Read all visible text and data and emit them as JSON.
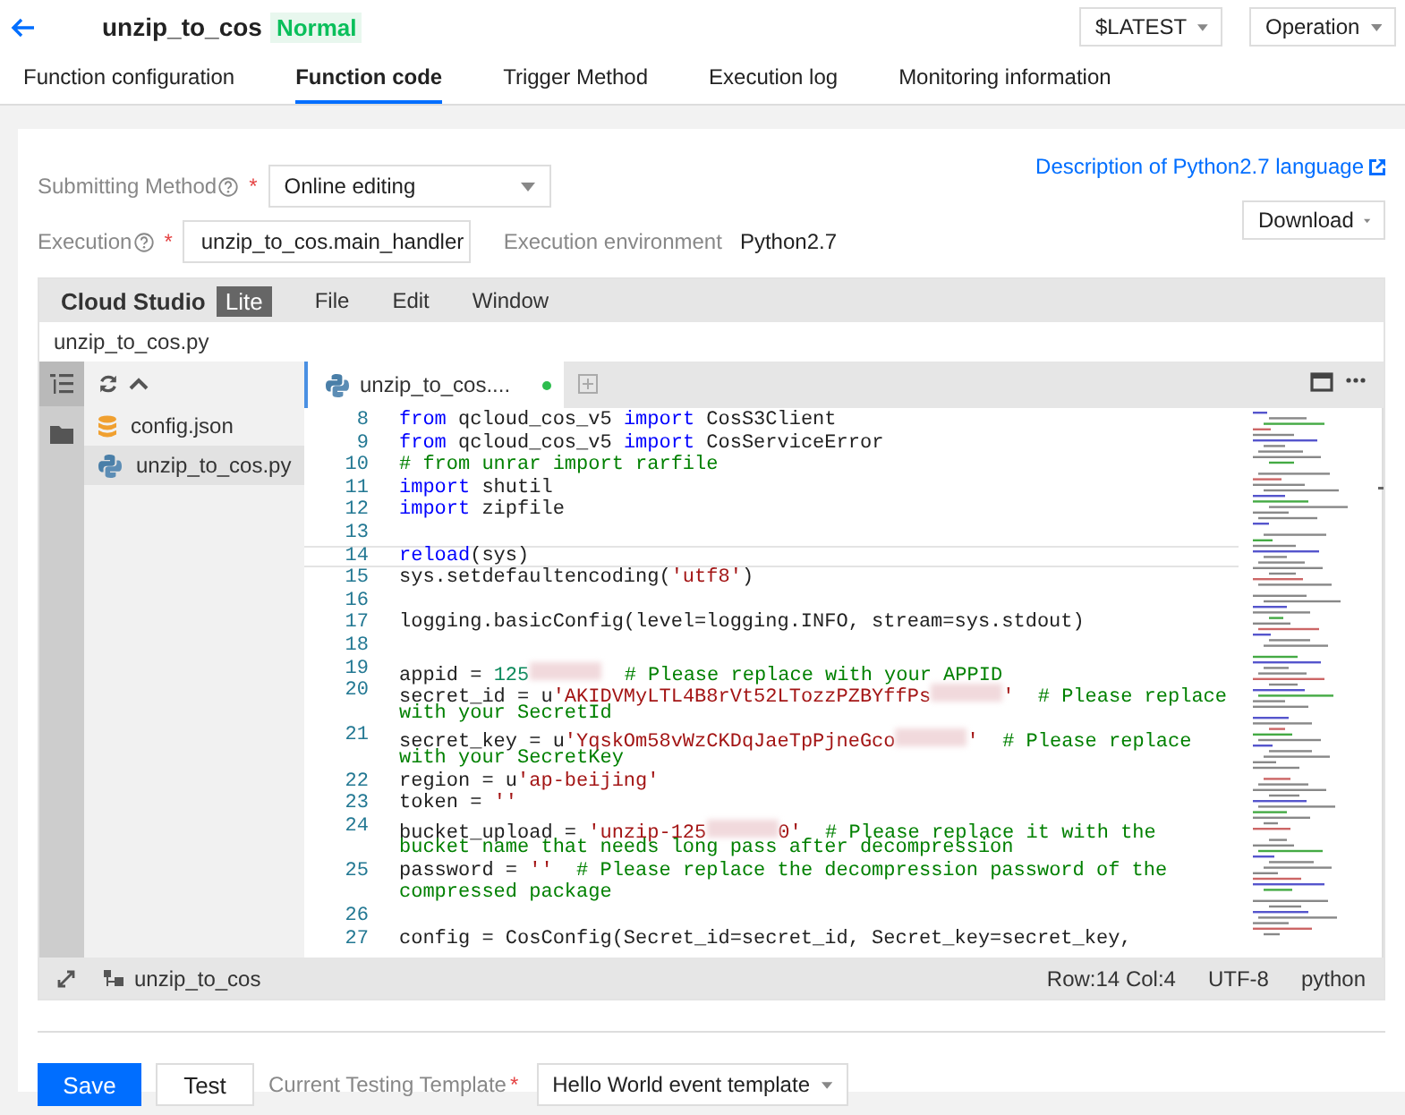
{
  "header": {
    "title": "unzip_to_cos",
    "status": "Normal",
    "version_select": "$LATEST",
    "operation_menu": "Operation"
  },
  "tabs": [
    {
      "label": "Function configuration",
      "selected": false
    },
    {
      "label": "Function code",
      "selected": true
    },
    {
      "label": "Trigger Method",
      "selected": false
    },
    {
      "label": "Execution log",
      "selected": false
    },
    {
      "label": "Monitoring information",
      "selected": false
    }
  ],
  "form": {
    "submitting_method": {
      "label": "Submitting Method",
      "required_mark": "*",
      "value": "Online editing"
    },
    "execution": {
      "label": "Execution",
      "required_mark": "*",
      "value": "unzip_to_cos.main_handler"
    },
    "environment": {
      "label": "Execution environment",
      "value": "Python2.7"
    },
    "language_link": "Description of Python2.7 language",
    "download_button": "Download"
  },
  "editor": {
    "brand": "Cloud Studio",
    "badge": "Lite",
    "menu": [
      "File",
      "Edit",
      "Window"
    ],
    "path": "unzip_to_cos.py",
    "files": [
      {
        "name": "config.json",
        "kind": "json",
        "selected": false
      },
      {
        "name": "unzip_to_cos.py",
        "kind": "python",
        "selected": true
      }
    ],
    "open_tab": {
      "label": "unzip_to_cos....",
      "modified": true
    },
    "rows": [
      {
        "num": "8",
        "current": false,
        "tokens": [
          {
            "kind": "keyword",
            "text": "from"
          },
          {
            "kind": "plain",
            "text": " qcloud_cos_v5 "
          },
          {
            "kind": "keyword",
            "text": "import"
          },
          {
            "kind": "plain",
            "text": " CosS3Client"
          }
        ]
      },
      {
        "num": "9",
        "current": false,
        "tokens": [
          {
            "kind": "keyword",
            "text": "from"
          },
          {
            "kind": "plain",
            "text": " qcloud_cos_v5 "
          },
          {
            "kind": "keyword",
            "text": "import"
          },
          {
            "kind": "plain",
            "text": " CosServiceError"
          }
        ]
      },
      {
        "num": "10",
        "current": false,
        "tokens": [
          {
            "kind": "comment",
            "text": "# from unrar import rarfile"
          }
        ]
      },
      {
        "num": "11",
        "current": false,
        "tokens": [
          {
            "kind": "keyword",
            "text": "import"
          },
          {
            "kind": "plain",
            "text": " shutil"
          }
        ]
      },
      {
        "num": "12",
        "current": false,
        "tokens": [
          {
            "kind": "keyword",
            "text": "import"
          },
          {
            "kind": "plain",
            "text": " zipfile"
          }
        ]
      },
      {
        "num": "13",
        "current": false,
        "tokens": []
      },
      {
        "num": "14",
        "current": true,
        "tokens": [
          {
            "kind": "keyword",
            "text": "reload"
          },
          {
            "kind": "plain",
            "text": "(sys)"
          }
        ]
      },
      {
        "num": "15",
        "current": false,
        "tokens": [
          {
            "kind": "plain",
            "text": "sys.setdefaultencoding("
          },
          {
            "kind": "string",
            "text": "'utf8'"
          },
          {
            "kind": "plain",
            "text": ")"
          }
        ]
      },
      {
        "num": "16",
        "current": false,
        "tokens": []
      },
      {
        "num": "17",
        "current": false,
        "tokens": [
          {
            "kind": "plain",
            "text": "logging.basicConfig(level=logging.INFO, stream=sys.stdout)"
          }
        ]
      },
      {
        "num": "18",
        "current": false,
        "tokens": []
      },
      {
        "num": "19",
        "current": false,
        "tokens": [
          {
            "kind": "plain",
            "text": "appid = "
          },
          {
            "kind": "number",
            "text": "125"
          },
          {
            "kind": "redacted"
          },
          {
            "kind": "comment",
            "text": "  # Please replace with your APPID"
          }
        ]
      },
      {
        "num": "20",
        "current": false,
        "tokens": [
          {
            "kind": "plain",
            "text": "secret_id = u"
          },
          {
            "kind": "string",
            "text": "'AKIDVMyLTL4B8rVt52LTozzPZBYffPs"
          },
          {
            "kind": "redacted"
          },
          {
            "kind": "string",
            "text": "'"
          },
          {
            "kind": "comment",
            "text": "  # Please replace"
          }
        ]
      },
      {
        "current": false,
        "tokens": [
          {
            "kind": "comment",
            "text": "with your SecretId"
          }
        ]
      },
      {
        "num": "21",
        "current": false,
        "tokens": [
          {
            "kind": "plain",
            "text": "secret_key = u"
          },
          {
            "kind": "string",
            "text": "'YqskOm58vWzCKDqJaeTpPjneGco"
          },
          {
            "kind": "redacted"
          },
          {
            "kind": "string",
            "text": "'"
          },
          {
            "kind": "comment",
            "text": "  # Please replace"
          }
        ]
      },
      {
        "current": false,
        "tokens": [
          {
            "kind": "comment",
            "text": "with your SecretKey"
          }
        ]
      },
      {
        "num": "22",
        "current": false,
        "tokens": [
          {
            "kind": "plain",
            "text": "region = u"
          },
          {
            "kind": "string",
            "text": "'ap-beijing'"
          }
        ]
      },
      {
        "num": "23",
        "current": false,
        "tokens": [
          {
            "kind": "plain",
            "text": "token = "
          },
          {
            "kind": "string",
            "text": "''"
          }
        ]
      },
      {
        "num": "24",
        "current": false,
        "tokens": [
          {
            "kind": "plain",
            "text": "bucket_upload = "
          },
          {
            "kind": "string",
            "text": "'unzip-125"
          },
          {
            "kind": "redacted"
          },
          {
            "kind": "string",
            "text": "0'"
          },
          {
            "kind": "comment",
            "text": "  # Please replace it with the"
          }
        ]
      },
      {
        "current": false,
        "tokens": [
          {
            "kind": "comment",
            "text": "bucket name that needs long pass after decompression"
          }
        ]
      },
      {
        "num": "25",
        "current": false,
        "tokens": [
          {
            "kind": "plain",
            "text": "password = "
          },
          {
            "kind": "string",
            "text": "''"
          },
          {
            "kind": "comment",
            "text": "  # Please replace the decompression password of the"
          }
        ]
      },
      {
        "current": false,
        "tokens": [
          {
            "kind": "comment",
            "text": "compressed package"
          }
        ]
      },
      {
        "num": "26",
        "current": false,
        "tokens": []
      },
      {
        "num": "27",
        "current": false,
        "tokens": [
          {
            "kind": "plain",
            "text": "config = CosConfig(Secret_id=secret_id, Secret_key=secret_key,"
          }
        ]
      }
    ],
    "project": "unzip_to_cos",
    "status": [
      "Row:14 Col:4",
      "UTF-8",
      "python"
    ]
  },
  "footer": {
    "save_button": "Save",
    "test_button": "Test",
    "template_label": "Current Testing Template",
    "required_mark": "*",
    "template_value": "Hello World event template"
  }
}
